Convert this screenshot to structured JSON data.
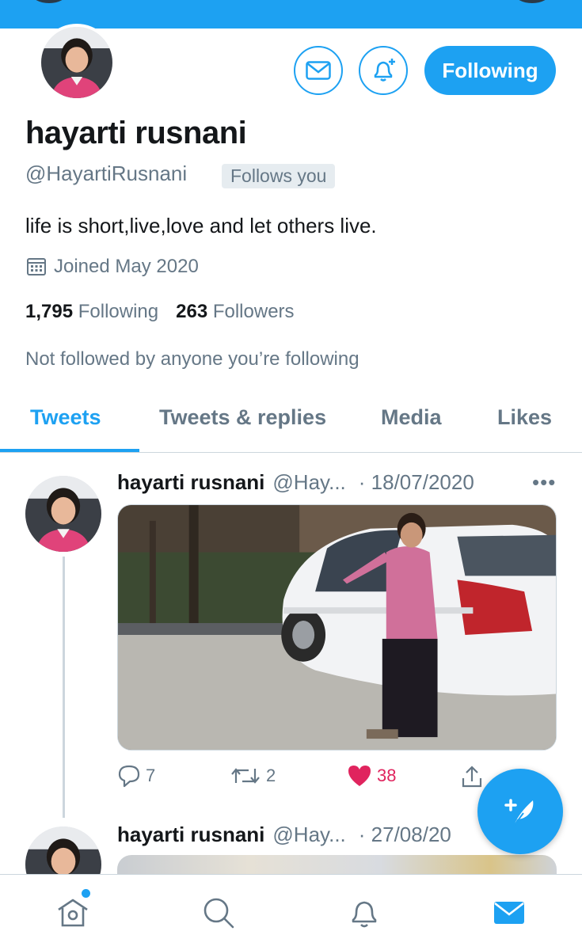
{
  "profile": {
    "name": "hayarti rusnani",
    "handle": "@HayartiRusnani",
    "follows_you": "Follows you",
    "bio": "life is short,live,love and let others live.",
    "joined": "Joined May 2020",
    "following_count": "1,795",
    "following_label": "Following",
    "followers_count": "263",
    "followers_label": "Followers",
    "not_followed": "Not followed by anyone you’re following"
  },
  "actions": {
    "follow_button": "Following"
  },
  "tabs": [
    {
      "label": "Tweets",
      "active": true
    },
    {
      "label": "Tweets & replies",
      "active": false
    },
    {
      "label": "Media",
      "active": false
    },
    {
      "label": "Likes",
      "active": false
    }
  ],
  "tweets": [
    {
      "name": "hayarti rusnani",
      "handle": "@Hay...",
      "date": "· 18/07/2020",
      "more": "•••",
      "replies": "7",
      "retweets": "2",
      "likes": "38",
      "liked": true
    },
    {
      "name": "hayarti rusnani",
      "handle": "@Hay...",
      "date": "· 27/08/20"
    }
  ],
  "icons": {
    "message": "envelope-icon",
    "notify": "bell-plus-icon",
    "calendar": "calendar-icon",
    "reply": "speech-bubble-icon",
    "retweet": "retweet-icon",
    "like": "heart-icon",
    "share": "share-icon",
    "compose": "quill-plus-icon",
    "nav": [
      "home-icon",
      "search-icon",
      "bell-icon",
      "envelope-icon"
    ]
  },
  "colors": {
    "accent": "#1da1f2",
    "like": "#e0245e",
    "muted": "#657786",
    "text": "#14171a"
  }
}
